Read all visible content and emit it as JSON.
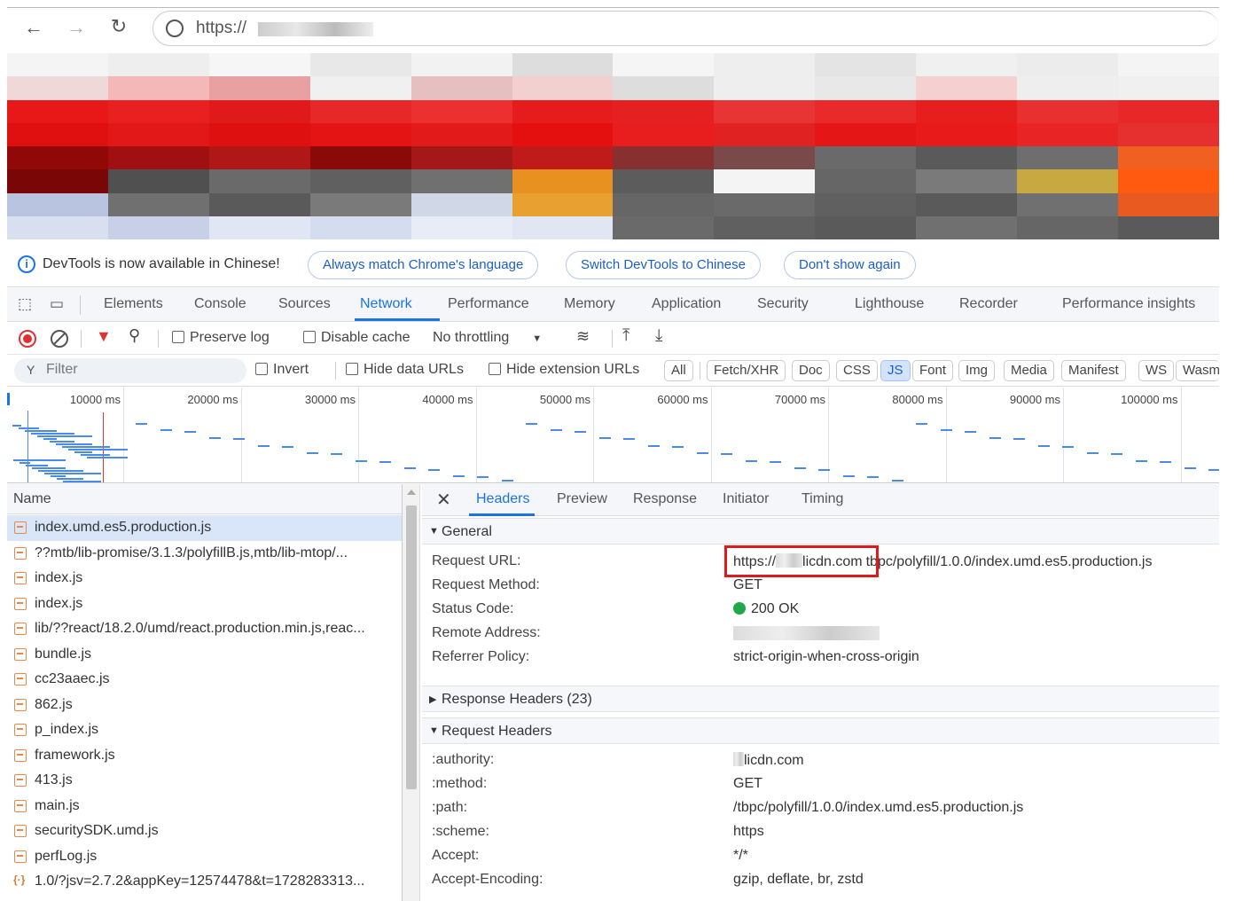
{
  "browser": {
    "url_prefix": "https://",
    "back_icon": "arrow-left-icon",
    "forward_icon": "arrow-right-icon",
    "reload_icon": "reload-icon"
  },
  "infobar": {
    "message": "DevTools is now available in Chinese!",
    "buttons": [
      "Always match Chrome's language",
      "Switch DevTools to Chinese",
      "Don't show again"
    ]
  },
  "tabs": [
    "Elements",
    "Console",
    "Sources",
    "Network",
    "Performance",
    "Memory",
    "Application",
    "Security",
    "Lighthouse",
    "Recorder",
    "Performance insights"
  ],
  "active_tab": "Network",
  "toolbar": {
    "preserve_log": "Preserve log",
    "disable_cache": "Disable cache",
    "throttling": "No throttling"
  },
  "filter": {
    "placeholder": "Filter",
    "invert": "Invert",
    "hide_data_urls": "Hide data URLs",
    "hide_extension_urls": "Hide extension URLs",
    "types": [
      "All",
      "Fetch/XHR",
      "Doc",
      "CSS",
      "JS",
      "Font",
      "Img",
      "Media",
      "Manifest",
      "WS",
      "Wasm"
    ],
    "active_type": "JS"
  },
  "timeline": {
    "ticks": [
      "10000 ms",
      "20000 ms",
      "30000 ms",
      "40000 ms",
      "50000 ms",
      "60000 ms",
      "70000 ms",
      "80000 ms",
      "90000 ms",
      "100000 ms"
    ]
  },
  "requests": {
    "header": "Name",
    "items": [
      "index.umd.es5.production.js",
      "??mtb/lib-promise/3.1.3/polyfillB.js,mtb/lib-mtop/...",
      "index.js",
      "index.js",
      "lib/??react/18.2.0/umd/react.production.min.js,reac...",
      "bundle.js",
      "cc23aaec.js",
      "862.js",
      "p_index.js",
      "framework.js",
      "413.js",
      "main.js",
      "securitySDK.umd.js",
      "perfLog.js",
      "1.0/?jsv=2.7.2&appKey=12574478&t=1728283313..."
    ]
  },
  "details": {
    "tabs": [
      "Headers",
      "Preview",
      "Response",
      "Initiator",
      "Timing"
    ],
    "general_title": "General",
    "general": [
      {
        "key": "Request URL:",
        "value_a": "https://",
        "value_b": "licdn.com",
        "value_c": "tbpc/polyfill/1.0.0/index.umd.es5.production.js"
      },
      {
        "key": "Request Method:",
        "value": "GET"
      },
      {
        "key": "Status Code:",
        "value": "200 OK"
      },
      {
        "key": "Remote Address:",
        "value": ""
      },
      {
        "key": "Referrer Policy:",
        "value": "strict-origin-when-cross-origin"
      }
    ],
    "response_headers_title": "Response Headers (23)",
    "request_headers_title": "Request Headers",
    "request_headers": [
      {
        "key": ":authority:",
        "value": "licdn.com"
      },
      {
        "key": ":method:",
        "value": "GET"
      },
      {
        "key": ":path:",
        "value": "/tbpc/polyfill/1.0.0/index.umd.es5.production.js"
      },
      {
        "key": ":scheme:",
        "value": "https"
      },
      {
        "key": "Accept:",
        "value": "*/*"
      },
      {
        "key": "Accept-Encoding:",
        "value": "gzip, deflate, br, zstd"
      }
    ]
  }
}
